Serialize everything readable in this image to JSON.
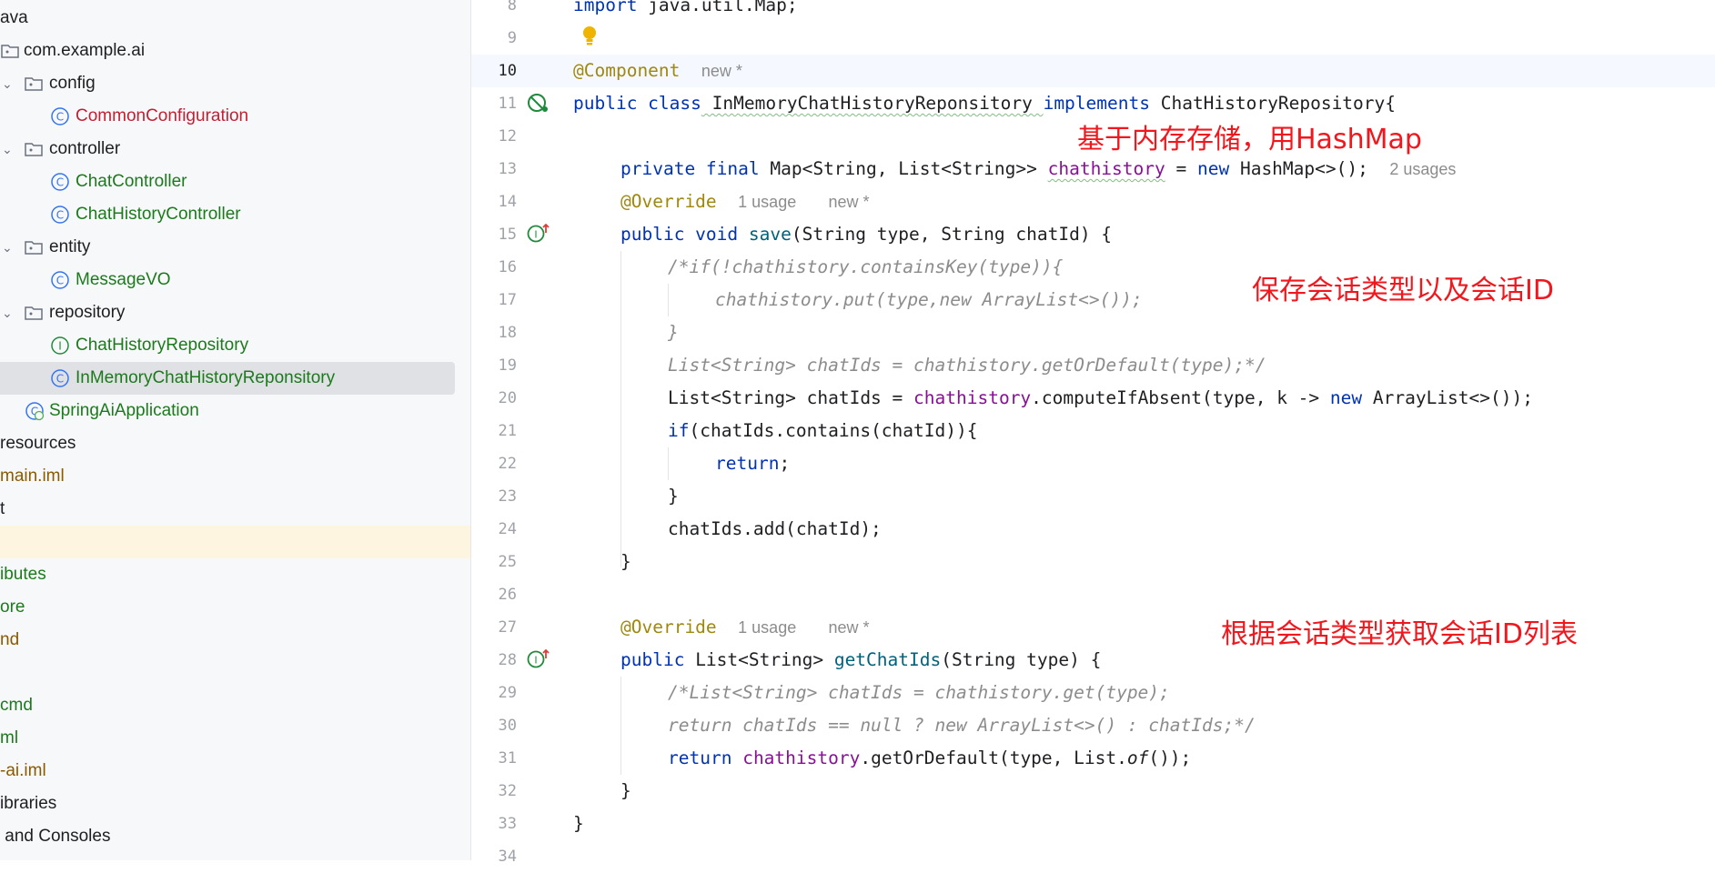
{
  "tree": {
    "items": [
      {
        "label": "ava",
        "color": "default"
      },
      {
        "label": "com.example.ai",
        "color": "default"
      },
      {
        "label": "config",
        "color": "default"
      },
      {
        "label": "CommonConfiguration",
        "color": "red"
      },
      {
        "label": "controller",
        "color": "default"
      },
      {
        "label": "ChatController",
        "color": "green"
      },
      {
        "label": "ChatHistoryController",
        "color": "green"
      },
      {
        "label": "entity",
        "color": "default"
      },
      {
        "label": "MessageVO",
        "color": "green"
      },
      {
        "label": "repository",
        "color": "default"
      },
      {
        "label": "ChatHistoryRepository",
        "color": "green"
      },
      {
        "label": "InMemoryChatHistoryReponsitory",
        "color": "green"
      },
      {
        "label": "SpringAiApplication",
        "color": "green"
      },
      {
        "label": "resources",
        "color": "default"
      },
      {
        "label": "main.iml",
        "color": "brown"
      },
      {
        "label": "t",
        "color": "default"
      },
      {
        "label": "",
        "color": "default"
      },
      {
        "label": "ibutes",
        "color": "green"
      },
      {
        "label": "ore",
        "color": "green"
      },
      {
        "label": "nd",
        "color": "brown"
      },
      {
        "label": "",
        "color": "default"
      },
      {
        "label": "cmd",
        "color": "green"
      },
      {
        "label": "ml",
        "color": "green"
      },
      {
        "label": "-ai.iml",
        "color": "brown"
      },
      {
        "label": "ibraries",
        "color": "default"
      },
      {
        "label": " and Consoles",
        "color": "default"
      }
    ]
  },
  "editor": {
    "line_numbers": [
      "8",
      "9",
      "10",
      "11",
      "12",
      "13",
      "14",
      "15",
      "16",
      "17",
      "18",
      "19",
      "20",
      "21",
      "22",
      "23",
      "24",
      "25",
      "26",
      "27",
      "28",
      "29",
      "30",
      "31",
      "32",
      "33",
      "34"
    ],
    "current_line": "10",
    "lines": {
      "l8": {
        "kw": "import",
        "rest": " java.util.Map;"
      },
      "l10": {
        "ann": "@Component",
        "hint": "new *"
      },
      "l11": {
        "kw1": "public class",
        "name": " InMemoryChatHistoryReponsitory ",
        "kw2": "implements",
        "rest": " ChatHistoryRepository{"
      },
      "l13": {
        "kw": "private final",
        "type": " Map<String, List<String>> ",
        "field": "chathistory",
        "eq": " = ",
        "kw2": "new",
        "rest": " HashMap<>();",
        "hint": "2 usages"
      },
      "l14": {
        "ann": "@Override",
        "hint1": "1 usage",
        "hint2": "new *"
      },
      "l15": {
        "kw": "public void",
        "fn": " save",
        "rest": "(String type, String chatId) {"
      },
      "l16": {
        "text": "/*if(!chathistory.containsKey(type)){"
      },
      "l17": {
        "text": "chathistory.put(type,new ArrayList<>());"
      },
      "l18": {
        "text": "}"
      },
      "l19": {
        "text": "List<String> chatIds = chathistory.getOrDefault(type);*/"
      },
      "l20": {
        "pre": "List<String> chatIds = ",
        "field": "chathistory",
        "mid": ".computeIfAbsent(type, k -> ",
        "kw": "new",
        "rest": " ArrayList<>());"
      },
      "l21": {
        "kw": "if",
        "rest": "(chatIds.contains(chatId)){"
      },
      "l22": {
        "kw": "return",
        "rest": ";"
      },
      "l23": {
        "text": "}"
      },
      "l24": {
        "text": "chatIds.add(chatId);"
      },
      "l25": {
        "text": "}"
      },
      "l27": {
        "ann": "@Override",
        "hint1": "1 usage",
        "hint2": "new *"
      },
      "l28": {
        "kw": "public",
        "type": " List<String> ",
        "fn": "getChatIds",
        "rest": "(String type) {"
      },
      "l29": {
        "text": "/*List<String> chatIds = chathistory.get(type);"
      },
      "l30": {
        "text": "return chatIds == null ? new ArrayList<>() : chatIds;*/"
      },
      "l31": {
        "kw": "return",
        "sp": " ",
        "field": "chathistory",
        "rest1": ".getOrDefault(type, List.",
        "of": "of",
        "rest2": "());"
      },
      "l32": {
        "text": "}"
      },
      "l33": {
        "text": "}"
      }
    }
  },
  "annotations": {
    "note1": "基于内存存储，用HashMap",
    "note2": "保存会话类型以及会话ID",
    "note3": "根据会话类型获取会话ID列表"
  },
  "colors": {
    "keyword": "#0033b3",
    "annotation": "#9e880d",
    "field": "#871094",
    "method": "#00627a",
    "comment": "#8c8c8c",
    "note": "#f2161d"
  }
}
